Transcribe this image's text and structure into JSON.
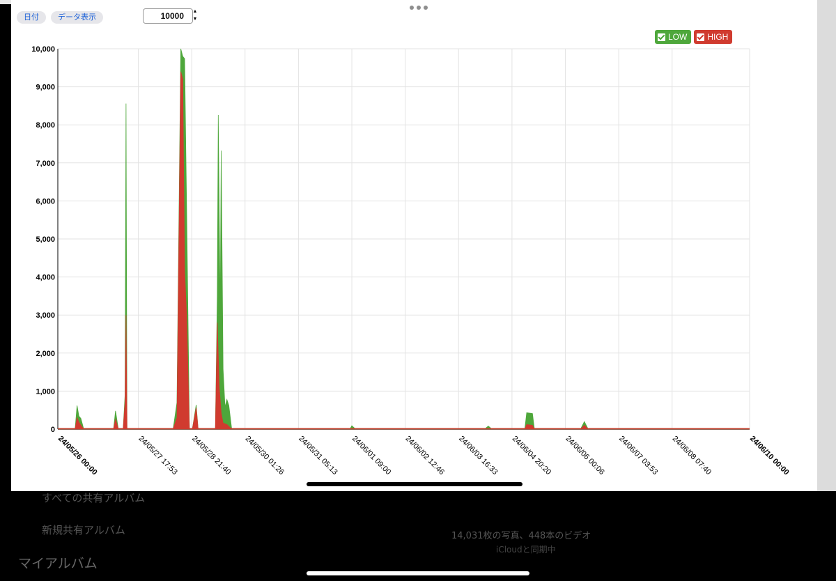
{
  "toolbar": {
    "date_label": "日付",
    "data_view_label": "データ表示",
    "stepper_value": "10000",
    "stepper_up_glyph": "▲",
    "stepper_down_glyph": "▼"
  },
  "legend": [
    {
      "label": "LOW",
      "color": "#4ea73b"
    },
    {
      "label": "HIGH",
      "color": "#d03b2f"
    }
  ],
  "background": {
    "album_item_1": "すべての共有アルバム",
    "album_item_2": "新規共有アルバム",
    "section": "マイアルバム",
    "photo_count": "14,031枚の写真、448本のビデオ",
    "icloud": "iCloudと同期中"
  },
  "chart_data": {
    "type": "area",
    "ylim": [
      0,
      10000
    ],
    "yticks": [
      "0",
      "1,000",
      "2,000",
      "3,000",
      "4,000",
      "5,000",
      "6,000",
      "7,000",
      "8,000",
      "9,000",
      "10,000"
    ],
    "xlim": [
      "24/05/26 00:00",
      "24/06/10 00:00"
    ],
    "xticks": [
      {
        "label": "24/05/26 00:00",
        "bold": true
      },
      {
        "label": "24/05/27 17:53",
        "bold": false
      },
      {
        "label": "24/05/28 21:40",
        "bold": false
      },
      {
        "label": "24/05/30 01:26",
        "bold": false
      },
      {
        "label": "24/05/31 05:13",
        "bold": false
      },
      {
        "label": "24/06/01 09:00",
        "bold": false
      },
      {
        "label": "24/06/02 12:46",
        "bold": false
      },
      {
        "label": "24/06/03 16:33",
        "bold": false
      },
      {
        "label": "24/06/04 20:20",
        "bold": false
      },
      {
        "label": "24/06/06 00:06",
        "bold": false
      },
      {
        "label": "24/06/07 03:53",
        "bold": false
      },
      {
        "label": "24/06/08 07:40",
        "bold": false
      },
      {
        "label": "24/06/10 00:00",
        "bold": true
      }
    ],
    "grid": true,
    "legend_position": "top-right",
    "series": [
      {
        "name": "LOW",
        "color": "#4ea73b",
        "points": [
          [
            "24/05/26 09:00",
            0
          ],
          [
            "24/05/26 10:00",
            620
          ],
          [
            "24/05/26 11:00",
            340
          ],
          [
            "24/05/26 12:00",
            280
          ],
          [
            "24/05/26 13:30",
            0
          ],
          [
            "24/05/27 05:00",
            0
          ],
          [
            "24/05/27 06:00",
            480
          ],
          [
            "24/05/27 07:30",
            0
          ],
          [
            "24/05/27 10:00",
            0
          ],
          [
            "24/05/27 11:00",
            900
          ],
          [
            "24/05/27 11:30",
            8560
          ],
          [
            "24/05/27 12:00",
            0
          ],
          [
            "24/05/28 12:00",
            0
          ],
          [
            "24/05/28 14:00",
            700
          ],
          [
            "24/05/28 16:00",
            10000
          ],
          [
            "24/05/28 17:00",
            9800
          ],
          [
            "24/05/28 18:00",
            9740
          ],
          [
            "24/05/28 19:00",
            5900
          ],
          [
            "24/05/28 20:30",
            0
          ],
          [
            "24/05/28 22:00",
            0
          ],
          [
            "24/05/29 00:00",
            640
          ],
          [
            "24/05/29 01:00",
            0
          ],
          [
            "24/05/29 10:00",
            0
          ],
          [
            "24/05/29 11:00",
            3500
          ],
          [
            "24/05/29 11:30",
            8260
          ],
          [
            "24/05/29 12:30",
            3000
          ],
          [
            "24/05/29 13:00",
            7320
          ],
          [
            "24/05/29 14:00",
            1580
          ],
          [
            "24/05/29 15:00",
            580
          ],
          [
            "24/05/29 16:00",
            780
          ],
          [
            "24/05/29 17:00",
            620
          ],
          [
            "24/05/29 18:30",
            0
          ],
          [
            "24/06/01 08:00",
            0
          ],
          [
            "24/06/01 09:00",
            90
          ],
          [
            "24/06/01 11:00",
            0
          ],
          [
            "24/06/04 06:00",
            0
          ],
          [
            "24/06/04 08:00",
            80
          ],
          [
            "24/06/04 10:00",
            0
          ],
          [
            "24/06/05 03:00",
            0
          ],
          [
            "24/06/05 04:00",
            430
          ],
          [
            "24/06/05 07:00",
            410
          ],
          [
            "24/06/05 08:00",
            0
          ],
          [
            "24/06/06 08:00",
            0
          ],
          [
            "24/06/06 10:00",
            200
          ],
          [
            "24/06/06 12:00",
            0
          ]
        ]
      },
      {
        "name": "HIGH",
        "color": "#d03b2f",
        "points": [
          [
            "24/05/26 09:00",
            0
          ],
          [
            "24/05/26 10:00",
            300
          ],
          [
            "24/05/26 11:00",
            180
          ],
          [
            "24/05/26 13:30",
            0
          ],
          [
            "24/05/27 05:00",
            0
          ],
          [
            "24/05/27 06:00",
            260
          ],
          [
            "24/05/27 07:30",
            0
          ],
          [
            "24/05/27 10:00",
            0
          ],
          [
            "24/05/27 11:00",
            700
          ],
          [
            "24/05/27 11:30",
            3000
          ],
          [
            "24/05/27 12:00",
            0
          ],
          [
            "24/05/28 12:00",
            0
          ],
          [
            "24/05/28 14:00",
            300
          ],
          [
            "24/05/28 16:00",
            9400
          ],
          [
            "24/05/28 17:00",
            9200
          ],
          [
            "24/05/28 18:00",
            4200
          ],
          [
            "24/05/28 19:00",
            3000
          ],
          [
            "24/05/28 20:30",
            0
          ],
          [
            "24/05/28 22:00",
            0
          ],
          [
            "24/05/29 00:00",
            560
          ],
          [
            "24/05/29 01:00",
            0
          ],
          [
            "24/05/29 10:00",
            0
          ],
          [
            "24/05/29 11:00",
            2800
          ],
          [
            "24/05/29 12:00",
            1100
          ],
          [
            "24/05/29 13:00",
            420
          ],
          [
            "24/05/29 14:00",
            160
          ],
          [
            "24/05/29 16:00",
            120
          ],
          [
            "24/05/29 18:30",
            0
          ],
          [
            "24/06/05 03:00",
            0
          ],
          [
            "24/06/05 04:00",
            120
          ],
          [
            "24/06/05 07:00",
            100
          ],
          [
            "24/06/05 08:00",
            0
          ],
          [
            "24/06/06 08:00",
            0
          ],
          [
            "24/06/06 10:00",
            100
          ],
          [
            "24/06/06 12:00",
            0
          ]
        ]
      }
    ]
  }
}
